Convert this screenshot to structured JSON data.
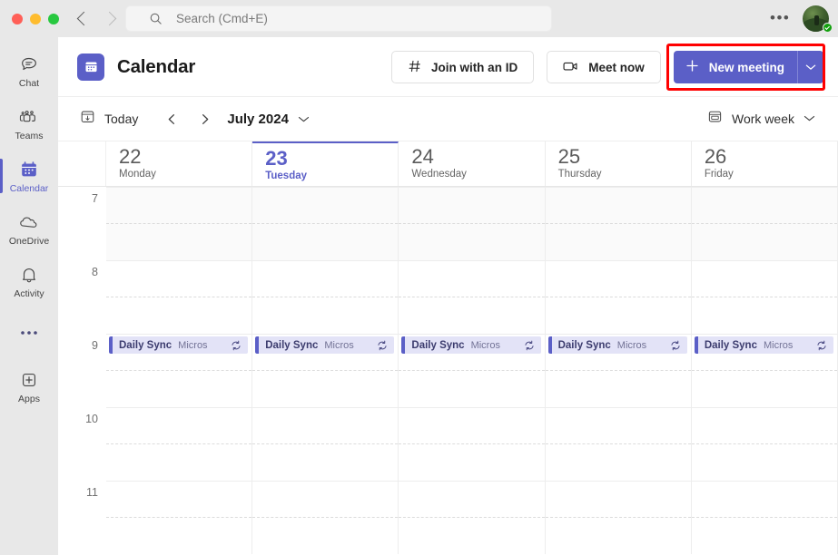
{
  "titlebar": {
    "search": {
      "placeholder": "Search (Cmd+E)",
      "value": ""
    },
    "more_label": "•••",
    "back_icon": "chevron-left-icon",
    "forward_icon": "chevron-right-icon"
  },
  "rail": {
    "items": [
      {
        "label": "Chat",
        "icon": "chat-icon",
        "active": false
      },
      {
        "label": "Teams",
        "icon": "teams-icon",
        "active": false
      },
      {
        "label": "Calendar",
        "icon": "calendar-icon",
        "active": true
      },
      {
        "label": "OneDrive",
        "icon": "cloud-icon",
        "active": false
      },
      {
        "label": "Activity",
        "icon": "bell-icon",
        "active": false
      },
      {
        "label": "",
        "icon": "more-dots-icon",
        "active": false
      },
      {
        "label": "Apps",
        "icon": "apps-plus-icon",
        "active": false
      }
    ]
  },
  "header": {
    "title": "Calendar",
    "app_icon": "calendar-icon",
    "join_label": "Join with an ID",
    "join_icon": "hash-icon",
    "meet_label": "Meet now",
    "meet_icon": "video-camera-icon",
    "new_meeting_label": "New meeting",
    "new_meeting_icon": "plus-icon",
    "new_meeting_caret_icon": "chevron-down-icon",
    "highlight_color": "#ff0000",
    "accent_color": "#5b5fc7"
  },
  "datebar": {
    "today_label": "Today",
    "today_icon": "calendar-today-icon",
    "prev_icon": "chevron-left-icon",
    "next_icon": "chevron-right-icon",
    "month_label": "July 2024",
    "month_caret_icon": "chevron-down-icon",
    "view_label": "Work week",
    "view_icon": "work-week-icon",
    "view_caret_icon": "chevron-down-icon"
  },
  "calendar": {
    "days": [
      {
        "num": "22",
        "name": "Monday",
        "today": false
      },
      {
        "num": "23",
        "name": "Tuesday",
        "today": true
      },
      {
        "num": "24",
        "name": "Wednesday",
        "today": false
      },
      {
        "num": "25",
        "name": "Thursday",
        "today": false
      },
      {
        "num": "26",
        "name": "Friday",
        "today": false
      }
    ],
    "hours": [
      "7",
      "8",
      "9",
      "10",
      "11"
    ],
    "event": {
      "title": "Daily Sync",
      "subtitle": "Micros",
      "recurrence_icon": "repeat-icon",
      "color": "#5b5fc7",
      "background": "#e3e3f7"
    }
  }
}
